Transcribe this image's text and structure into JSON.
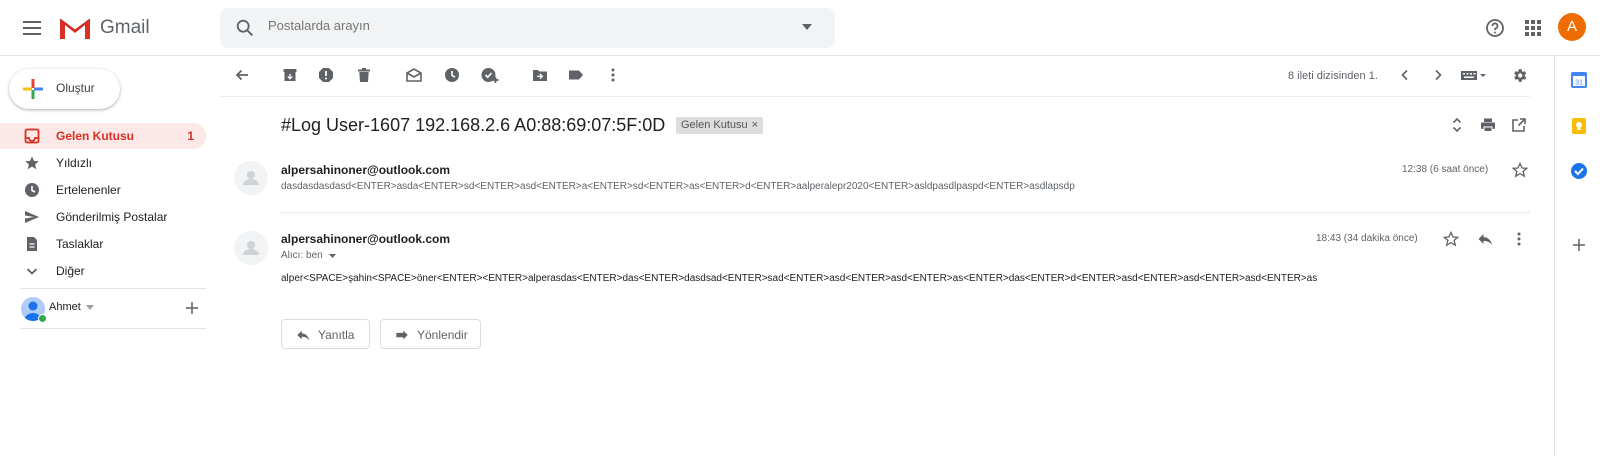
{
  "app": {
    "name": "Gmail",
    "logo_icon": "gmail-m-logo"
  },
  "search": {
    "placeholder": "Postalarda arayın"
  },
  "account": {
    "avatar_letter": "A",
    "avatar_color": "#ef6c00"
  },
  "compose": {
    "label": "Oluştur"
  },
  "nav": {
    "items": [
      {
        "label": "Gelen Kutusu",
        "icon": "inbox-icon",
        "count": "1",
        "active": true
      },
      {
        "label": "Yıldızlı",
        "icon": "star-icon"
      },
      {
        "label": "Ertelenenler",
        "icon": "clock-icon"
      },
      {
        "label": "Gönderilmiş Postalar",
        "icon": "send-icon"
      },
      {
        "label": "Taslaklar",
        "icon": "draft-icon"
      },
      {
        "label": "Diğer",
        "icon": "chevron-down-icon"
      }
    ]
  },
  "hangouts": {
    "user": "Ahmet"
  },
  "toolbar": {
    "pager": "8 ileti dizisinden 1.",
    "icons": [
      "back-icon",
      "archive-icon",
      "spam-icon",
      "delete-icon",
      "mark-unread-icon",
      "snooze-icon",
      "add-task-icon",
      "move-to-icon",
      "label-icon",
      "more-icon",
      "prev-icon",
      "next-icon",
      "keyboard-icon",
      "settings-icon"
    ]
  },
  "thread": {
    "subject": "#Log User-1607 192.168.2.6 A0:88:69:07:5F:0D",
    "label": "Gelen Kutusu",
    "messages": [
      {
        "sender": "alpersahinoner@outlook.com",
        "snippet": "dasdasdasdasd<ENTER>asda<ENTER>sd<ENTER>asd<ENTER>a<ENTER>sd<ENTER>as<ENTER>d<ENTER>aalperalepr2020<ENTER>asldpasdlpaspd<ENTER>asdlapsdp",
        "time": "12:38 (6 saat önce)"
      },
      {
        "sender": "alpersahinoner@outlook.com",
        "to": "Alıcı: ben",
        "time": "18:43 (34 dakika önce)",
        "body": "alper<SPACE>şahin<SPACE>öner<ENTER><ENTER>alperasdas<ENTER>das<ENTER>dasdsad<ENTER>sad<ENTER>asd<ENTER>asd<ENTER>as<ENTER>das<ENTER>d<ENTER>asd<ENTER>asd<ENTER>asd<ENTER>as"
      }
    ],
    "reply_label": "Yanıtla",
    "forward_label": "Yönlendir"
  },
  "colors": {
    "accent_red": "#d93025",
    "active_bg": "#fce8e6",
    "search_bg": "#f1f3f4"
  }
}
